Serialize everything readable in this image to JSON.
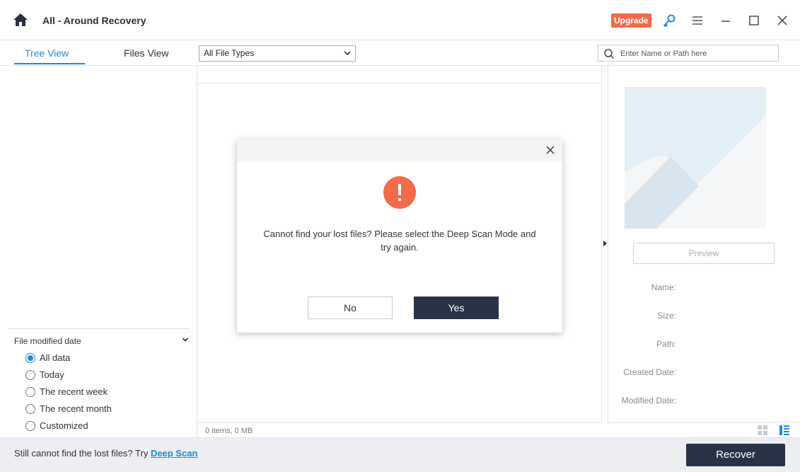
{
  "window": {
    "title": "All - Around Recovery",
    "upgrade_label": "Upgrade",
    "icons": [
      "home-icon",
      "key-icon",
      "menu-icon",
      "minimize-icon",
      "maximize-icon",
      "close-icon"
    ]
  },
  "tabs": {
    "tree_view": "Tree View",
    "files_view": "Files View",
    "active": "Tree View"
  },
  "toolbar": {
    "file_type_selected": "All File Types",
    "search_placeholder": "Enter Name or Path here"
  },
  "filter": {
    "title": "File modified date",
    "options": [
      {
        "label": "All data",
        "checked": true
      },
      {
        "label": "Today",
        "checked": false
      },
      {
        "label": "The recent week",
        "checked": false
      },
      {
        "label": "The recent month",
        "checked": false
      },
      {
        "label": "Customized",
        "checked": false
      }
    ]
  },
  "status": {
    "items_text": "0 items, 0 MB"
  },
  "preview": {
    "button_label": "Preview",
    "labels": {
      "name": "Name:",
      "size": "Size:",
      "path": "Path:",
      "created": "Created Date:",
      "modified": "Modified Date:"
    }
  },
  "footer": {
    "hint_prefix": "Still cannot find the lost files? Try ",
    "deep_scan_link": "Deep Scan",
    "recover_label": "Recover"
  },
  "dialog": {
    "message": "Cannot find your lost files? Please select the Deep Scan Mode and try again.",
    "no_label": "No",
    "yes_label": "Yes"
  },
  "colors": {
    "accent": "#1f8bd6",
    "upgrade": "#f26b4a",
    "primary_button": "#283347",
    "warning": "#f26b4a"
  }
}
